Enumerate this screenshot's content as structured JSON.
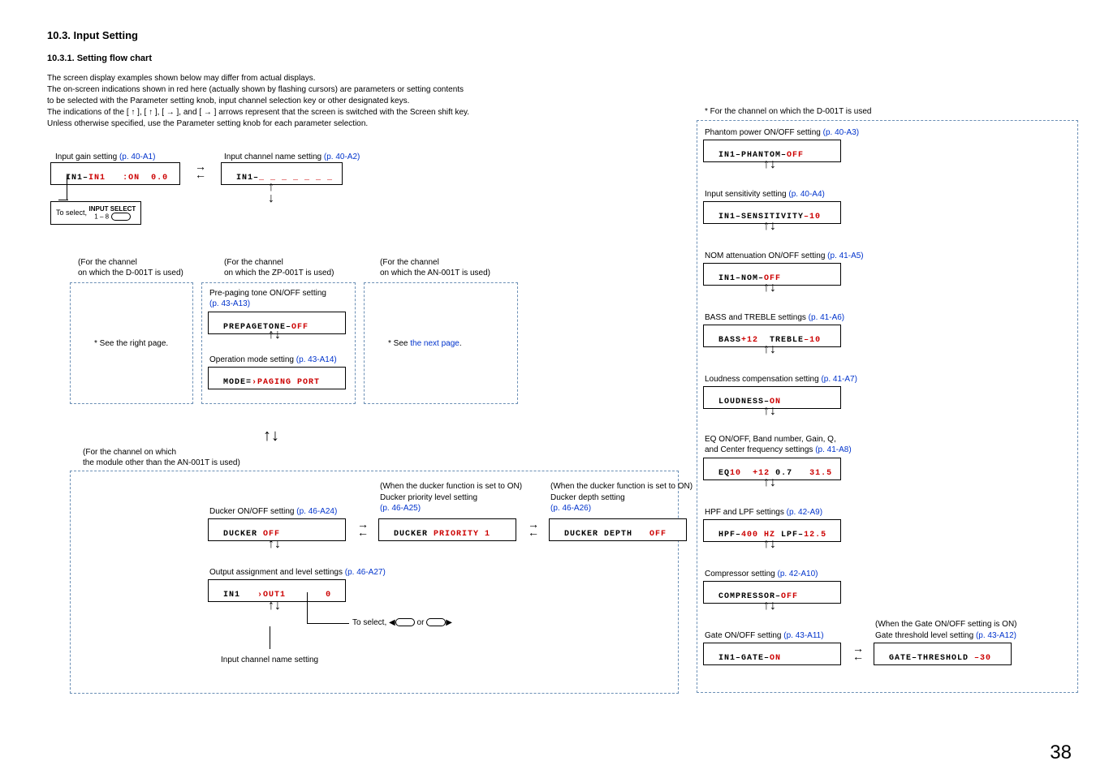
{
  "header": {
    "section_title": "10.3. Input Setting",
    "sub_title": "10.3.1. Setting flow chart",
    "desc_l1": "The screen display examples shown below may differ from actual displays.",
    "desc_l2": "The on-screen indications shown in red here (actually shown by flashing cursors) are parameters or setting contents",
    "desc_l3": "to be selected with the Parameter setting knob, input channel selection key or other designated keys.",
    "desc_l4a": "The indications of the [ ",
    "desc_l4arrow1": "↑",
    "desc_l4b": " ], [ ",
    "desc_l4arrow2": "↑",
    "desc_l4c": " ], [ ",
    "desc_l4arrow3": "→",
    "desc_l4d": " ], and [ ",
    "desc_l4arrow4": "→",
    "desc_l4e": " ] arrows represent that the screen is switched with the Screen shift key.",
    "desc_l5": "Unless otherwise specified, use the Parameter setting knob for each parameter selection."
  },
  "left": {
    "input_gain_label": "Input gain setting ",
    "input_gain_ref": "(p. 40-A1)",
    "lcd_gain_a": "IN1",
    "lcd_gain_sep": "–",
    "lcd_gain_b": "IN1",
    "lcd_gain_c": ":ON",
    "lcd_gain_d": "0.0",
    "to_select": "To select, ",
    "input_select": "INPUT SELECT",
    "one_eight": "1 – 8",
    "input_name_label": "Input channel name setting ",
    "input_name_ref": "(p. 40-A2)",
    "lcd_name": "IN1–",
    "lcd_name_placeholder": "_ _ _ _ _ _ _",
    "for_d001t_l1": "(For the channel",
    "for_d001t_l2": "on which the D-001T is used)",
    "see_right": "* See the right page.",
    "for_zp001t_l1": "(For the channel",
    "for_zp001t_l2": "on which the ZP-001T is used)",
    "prepage_label": "Pre-paging tone ON/OFF setting",
    "prepage_ref": "(p. 43-A13)",
    "lcd_prepage_a": "PREPAGETONE–",
    "lcd_prepage_b": "OFF",
    "opmode_label": "Operation mode setting ",
    "opmode_ref": "(p. 43-A14)",
    "lcd_opmode_a": "MODE=",
    "lcd_opmode_arrow": "›",
    "lcd_opmode_b": "PAGING PORT",
    "for_an001t_l1": "(For the channel",
    "for_an001t_l2": "on which the AN-001T is used)",
    "see_next_a": "* See ",
    "see_next_b": "the next page",
    "see_next_c": ".",
    "for_other_l1": "(For the channel on which",
    "for_other_l2": "the module other than the AN-001T is used)",
    "ducker_onoff_label": "Ducker ON/OFF setting ",
    "ducker_onoff_ref": "(p. 46-A24)",
    "lcd_ducker_a": "DUCKER ",
    "lcd_ducker_b": "OFF",
    "when_ducker_on": "(When the ducker function is set to ON)",
    "ducker_prio_label": "Ducker priority level setting",
    "ducker_prio_ref": "(p. 46-A25)",
    "lcd_duckerpri_a": "DUCKER ",
    "lcd_duckerpri_b": "PRIORITY 1",
    "ducker_depth_label": "Ducker depth setting",
    "ducker_depth_ref": "(p. 46-A26)",
    "lcd_duckerdepth_a": "DUCKER DEPTH   ",
    "lcd_duckerdepth_b": "OFF",
    "output_assign_label": "Output assignment and level settings ",
    "output_assign_ref": "(p. 46-A27)",
    "lcd_out_a": "IN1   ",
    "lcd_out_arrow": "›",
    "lcd_out_b": "OUT1",
    "lcd_out_c": "       ",
    "lcd_out_d": "0",
    "to_select2a": "To select, ",
    "to_select2b": " or ",
    "input_name_setting_bottom": "Input channel name setting",
    "triangle_left": "◀",
    "triangle_right": "▶"
  },
  "right": {
    "header": "* For the channel on which the D-001T is used",
    "phantom_label": "Phantom power ON/OFF setting ",
    "phantom_ref": "(p. 40-A3)",
    "lcd_phantom_a": "IN1–PHANTOM–",
    "lcd_phantom_b": "OFF",
    "sens_label": "Input sensitivity setting ",
    "sens_ref": "(p. 40-A4)",
    "lcd_sens_a": "IN1–SENSITIVITY",
    "lcd_sens_b": "–10",
    "nom_label": "NOM attenuation ON/OFF setting ",
    "nom_ref": "(p. 41-A5)",
    "lcd_nom_a": "IN1–NOM–",
    "lcd_nom_b": "OFF",
    "bt_label": "BASS and TREBLE settings ",
    "bt_ref": "(p. 41-A6)",
    "lcd_bt_a": "BASS",
    "lcd_bt_b": "+12",
    "lcd_bt_c": "  TREBLE",
    "lcd_bt_d": "–10",
    "loud_label": "Loudness compensation setting ",
    "loud_ref": "(p. 41-A7)",
    "lcd_loud_a": "LOUDNESS–",
    "lcd_loud_b": "ON",
    "eq_label_l1": "EQ ON/OFF, Band number, Gain, Q,",
    "eq_label_l2": "and Center frequency settings ",
    "eq_ref": "(p. 41-A8)",
    "lcd_eq_a": "EQ",
    "lcd_eq_b": "10",
    "lcd_eq_c": "  ",
    "lcd_eq_d": "+12",
    "lcd_eq_e": " 0.7   ",
    "lcd_eq_f": "31.5",
    "hpf_label": "HPF and LPF settings ",
    "hpf_ref": "(p. 42-A9)",
    "lcd_hpf_a": "HPF–",
    "lcd_hpf_b": "400 HZ",
    "lcd_hpf_c": " LPF–",
    "lcd_hpf_d": "12.5",
    "comp_label": "Compressor setting ",
    "comp_ref": "(p. 42-A10)",
    "lcd_comp_a": "COMPRESSOR–",
    "lcd_comp_b": "OFF",
    "gate_label": "Gate ON/OFF setting ",
    "gate_ref": "(p. 43-A11)",
    "lcd_gate_a": "IN1–GATE–",
    "lcd_gate_b": "ON",
    "when_gate_on": "(When the Gate ON/OFF setting is ON)",
    "gatethr_label": "Gate threshold level setting ",
    "gatethr_ref": "(p. 43-A12)",
    "lcd_gatethr_a": "GATE–THRESHOLD ",
    "lcd_gatethr_b": "–30"
  },
  "arrows": {
    "ud": "↑↓",
    "rl_top": "→",
    "rl_bot": "←"
  },
  "page_num": "38"
}
